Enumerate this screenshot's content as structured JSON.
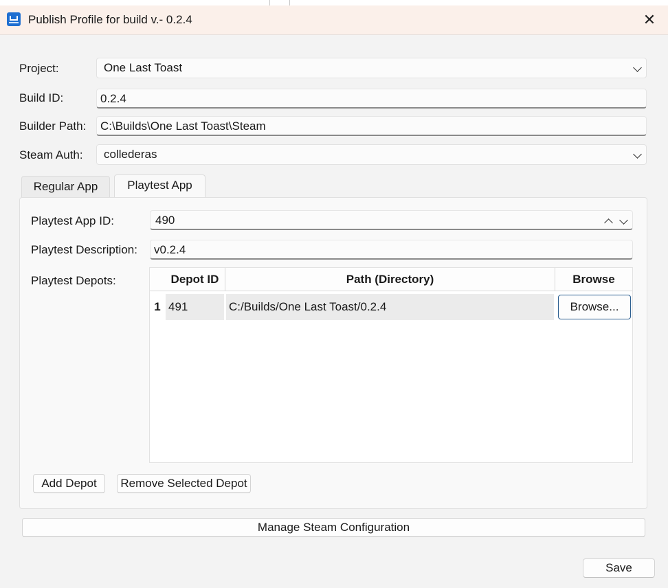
{
  "window": {
    "title": "Publish Profile for build v.- 0.2.4"
  },
  "form": {
    "project_label": "Project:",
    "project_value": "One Last Toast",
    "build_id_label": "Build ID:",
    "build_id_value": "0.2.4",
    "builder_path_label": "Builder Path:",
    "builder_path_value": "C:\\Builds\\One Last Toast\\Steam",
    "steam_auth_label": "Steam Auth:",
    "steam_auth_value": "collederas"
  },
  "tabs": [
    {
      "label": "Regular App",
      "active": false
    },
    {
      "label": "Playtest App",
      "active": true
    }
  ],
  "playtest": {
    "app_id_label": "Playtest App ID:",
    "app_id_value": "490",
    "description_label": "Playtest Description:",
    "description_value": "v0.2.4",
    "depots_label": "Playtest Depots:"
  },
  "depots_table": {
    "columns": [
      "Depot ID",
      "Path (Directory)",
      "Browse"
    ],
    "rows": [
      {
        "index": "1",
        "depot_id": "491",
        "path": "C:/Builds/One Last Toast/0.2.4",
        "browse_label": "Browse..."
      }
    ]
  },
  "buttons": {
    "add_depot": "Add Depot",
    "remove_depot": "Remove Selected Depot",
    "manage_config": "Manage Steam Configuration",
    "save": "Save"
  },
  "icons": {
    "app": "app-logo-icon",
    "close": "close-icon",
    "dropdown": "chevron-down-icon",
    "spin_up": "chevron-up-icon"
  },
  "colors": {
    "titlebar": "#fbf0ea",
    "focus_border": "#2a5d8f",
    "window_bg": "#f3f3f3"
  }
}
